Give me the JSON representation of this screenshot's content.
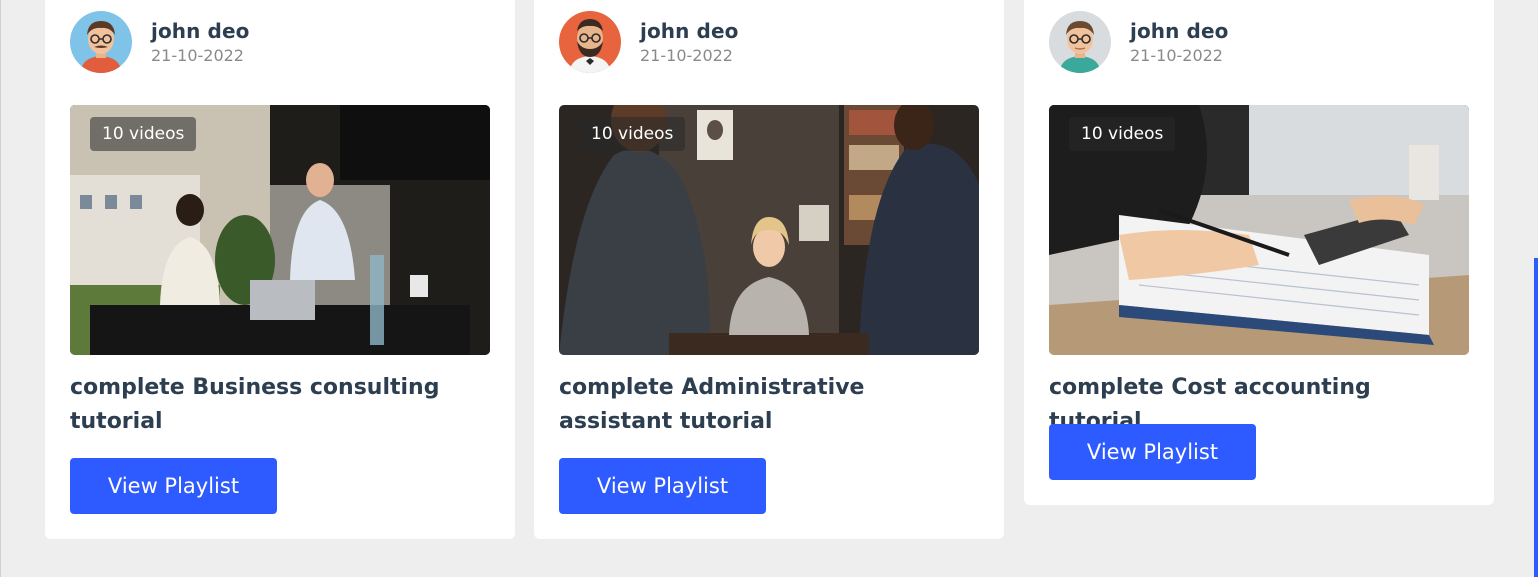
{
  "cards": [
    {
      "tutor_name": "john deo",
      "date": "21-10-2022",
      "videos": "10 videos",
      "title": "complete Business consulting tutorial",
      "button": "View Playlist",
      "avatar_color": "#7fc3e8"
    },
    {
      "tutor_name": "john deo",
      "date": "21-10-2022",
      "videos": "10 videos",
      "title": "complete Administrative assistant tutorial",
      "button": "View Playlist",
      "avatar_color": "#e8643f"
    },
    {
      "tutor_name": "john deo",
      "date": "21-10-2022",
      "videos": "10 videos",
      "title": "complete Cost accounting tutorial",
      "button": "View Playlist",
      "avatar_color": "#d9dcdf"
    }
  ],
  "colors": {
    "accent": "#2e5bff",
    "background": "#eeeeee",
    "heading": "#2c3e50",
    "muted": "#8a8a8a"
  }
}
